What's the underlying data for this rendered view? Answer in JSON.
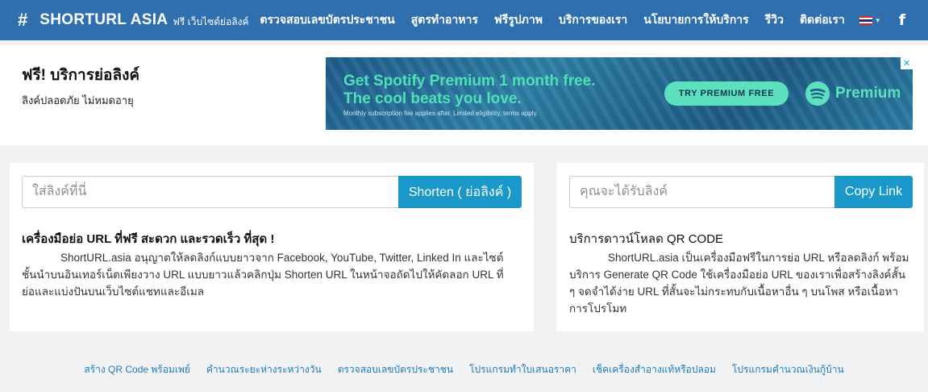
{
  "nav": {
    "brand_symbol": "#",
    "brand_name": "SHORTURL ASIA",
    "brand_tagline": "ฟรี เว็บไซต์ย่อลิงค์",
    "links": [
      "ตรวจสอบเลขบัตรประชาชน",
      "สูตรทำอาหาร",
      "ฟรีรูปภาพ",
      "บริการของเรา",
      "นโยบายการให้บริการ",
      "รีวิว",
      "ติดต่อเรา"
    ],
    "language_flag": "thailand-flag-icon",
    "social_icon": "facebook-icon",
    "social_glyph": "f",
    "bg_color": "#2f6fae"
  },
  "hero": {
    "title": "ฟรี! บริการย่อลิงค์",
    "subtitle": "ลิงค์ปลอดภัย ไม่หมดอายุ"
  },
  "ad": {
    "headline_line1": "Get Spotify Premium 1 month free.",
    "headline_line2": "The cool beats you love.",
    "fine_print": "Monthly subscription fee applies after. Limited eligibility, terms apply.",
    "button_label": "TRY PREMIUM FREE",
    "logo_text": "Premium",
    "close_glyph": "✕"
  },
  "shorten": {
    "placeholder": "ใส่ลิงค์ที่นี่",
    "button_label": "Shorten ( ย่อลิงค์ )",
    "heading": "เครื่องมือย่อ URL ที่ฟรี สะดวก และรวดเร็ว ที่สุด !",
    "body": "ShortURL.asia อนุญาตให้ลดลิงก์แบบยาวจาก Facebook, YouTube, Twitter, Linked In และไซต์ชั้นนำบนอินเทอร์เน็ตเพียงวาง URL แบบยาวแล้วคลิกปุ่ม Shorten URL ในหน้าจอถัดไปให้คัดลอก URL ที่ย่อและแบ่งปันบนเว็บไซต์แชทและอีเมล"
  },
  "qr": {
    "placeholder": "คุณจะได้รับลิงค์",
    "button_label": "Copy Link",
    "heading": "บริการดาวน์โหลด QR CODE",
    "body": "ShortURL.asia เป็นเครื่องมือฟรีในการย่อ URL หรือลดลิงก์ พร้อมบริการ Generate QR Code ใช้เครื่องมือย่อ URL ของเราเพื่อสร้างลิงค์สั้น ๆ จดจำได้ง่าย URL ที่สั้นจะไม่กระทบกับเนื้อหาอื่น ๆ บนโพส หรือเนื้อหาการโปรโมท"
  },
  "footer": {
    "links": [
      "สร้าง QR Code พร้อมเพย์",
      "คำนวณระยะห่างระหว่างวัน",
      "ตรวจสอบเลขบัตรประชาชน",
      "โปรแกรมทำใบเสนอราคา",
      "เช็คเครื่องสำอางแท้หรือปลอม",
      "โปรแกรมคำนวณเงินกู้บ้าน"
    ]
  },
  "colors": {
    "accent": "#1a98c9",
    "link": "#1c7bb7",
    "ad_green": "#5ce0be"
  }
}
